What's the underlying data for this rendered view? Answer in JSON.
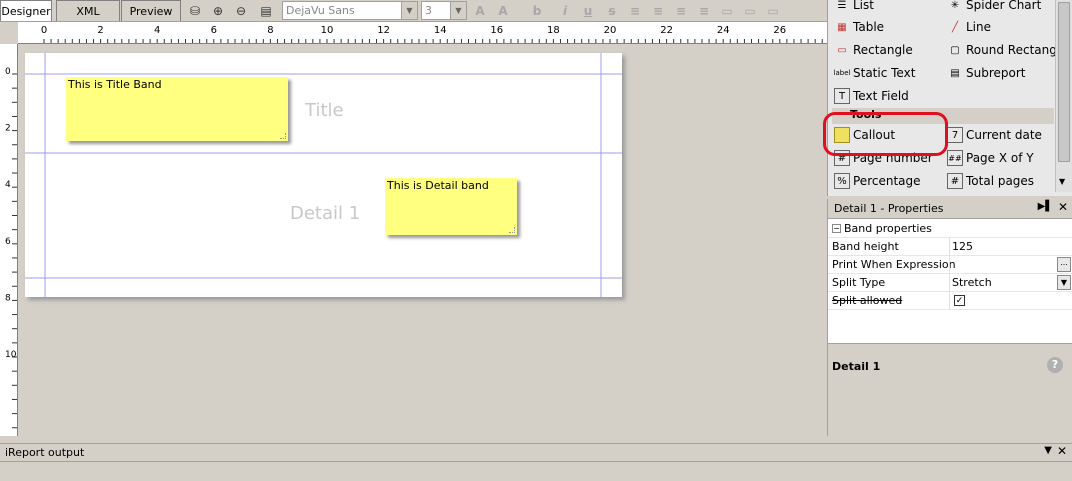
{
  "tabs": [
    "Designer",
    "XML",
    "Preview"
  ],
  "toolbar": {
    "font_family": "DejaVu Sans",
    "font_size": "3"
  },
  "ruler": {
    "h_labels": [
      "0",
      "2",
      "4",
      "6",
      "8",
      "10",
      "12",
      "14",
      "16",
      "18",
      "20",
      "22",
      "24",
      "26"
    ],
    "v_labels": [
      "0",
      "2",
      "4",
      "6",
      "8",
      "10"
    ]
  },
  "bands": {
    "title": "Title",
    "detail": "Detail 1"
  },
  "callouts": {
    "title_note": "This is Title Band",
    "detail_note": "This is Detail band"
  },
  "palette": {
    "items": [
      {
        "label": "List",
        "icon": "list-icon"
      },
      {
        "label": "Spider Chart",
        "icon": "spider-chart-icon"
      },
      {
        "label": "Table",
        "icon": "table-icon"
      },
      {
        "label": "Line",
        "icon": "line-icon"
      },
      {
        "label": "Rectangle",
        "icon": "rectangle-icon"
      },
      {
        "label": "Round Rectangle",
        "icon": "round-rectangle-icon"
      },
      {
        "label": "Static Text",
        "icon": "static-text-icon"
      },
      {
        "label": "Subreport",
        "icon": "subreport-icon"
      },
      {
        "label": "Text Field",
        "icon": "text-field-icon"
      }
    ],
    "tools_header": "Tools",
    "tools": [
      {
        "label": "Callout",
        "icon": "callout-icon"
      },
      {
        "label": "Current date",
        "icon": "calendar-icon"
      },
      {
        "label": "Page number",
        "icon": "page-number-icon"
      },
      {
        "label": "Page X of Y",
        "icon": "page-x-of-y-icon"
      },
      {
        "label": "Percentage",
        "icon": "percentage-icon"
      },
      {
        "label": "Total pages",
        "icon": "total-pages-icon"
      }
    ],
    "highlight_color": "#e01020"
  },
  "properties": {
    "title": "Detail 1 - Properties",
    "section": "Band properties",
    "rows": [
      {
        "key": "Band height",
        "value": "125"
      },
      {
        "key": "Print When Expression",
        "value": ""
      },
      {
        "key": "Split Type",
        "value": "Stretch"
      },
      {
        "key": "Split allowed",
        "value": "✓"
      }
    ],
    "description_title": "Detail 1"
  },
  "output": {
    "title": "iReport output"
  },
  "colors": {
    "callout_fill": "#ffff80",
    "band_line": "#9c9cf0"
  }
}
